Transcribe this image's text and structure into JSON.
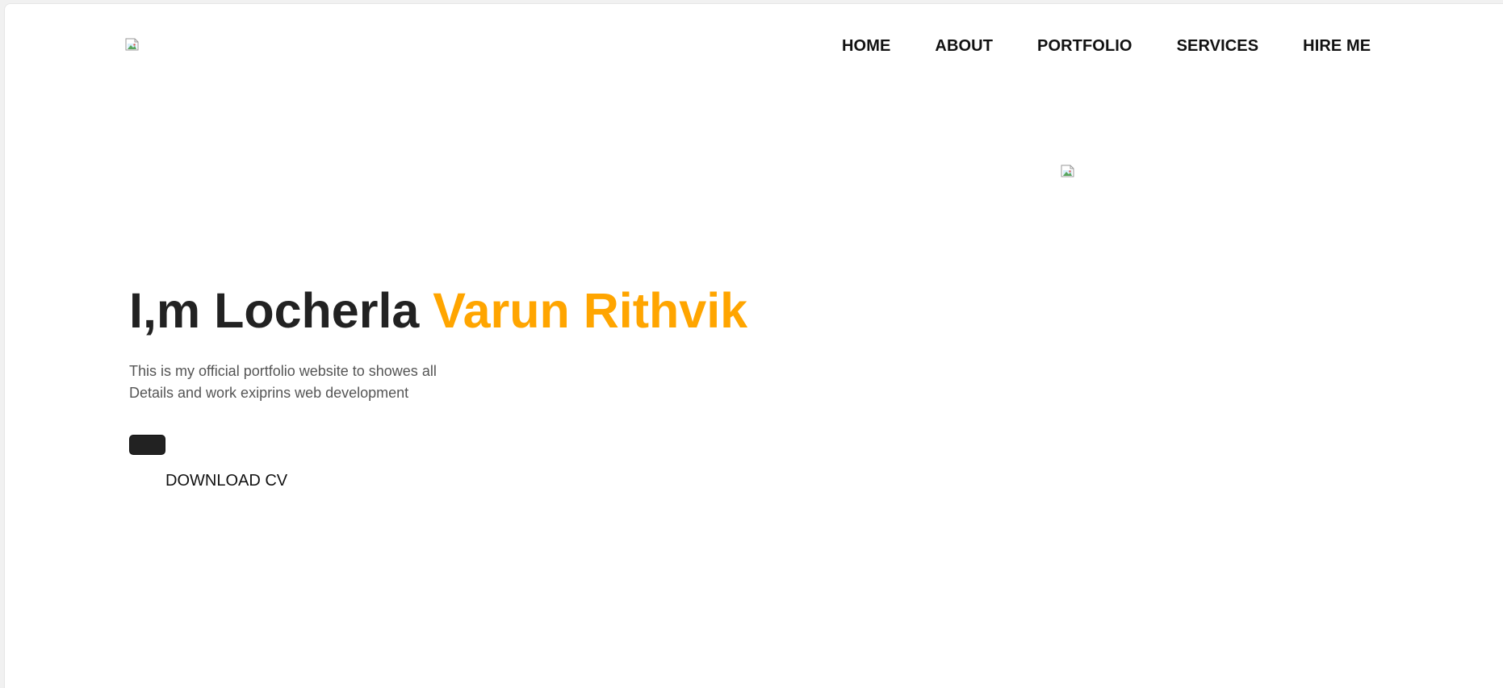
{
  "nav": {
    "items": [
      {
        "label": "HOME"
      },
      {
        "label": "ABOUT"
      },
      {
        "label": "PORTFOLIO"
      },
      {
        "label": "SERVICES"
      },
      {
        "label": "HIRE ME"
      }
    ]
  },
  "hero": {
    "headline_prefix": "I,m Locherla ",
    "headline_name": "Varun Rithvik",
    "description_line1": "This is my official portfolio website to showes all",
    "description_line2": "Details and work exiprins web development",
    "download_label": "DOWNLOAD CV"
  },
  "colors": {
    "accent": "#ffa500",
    "heading": "#222222",
    "body_text": "#555555",
    "button_bg": "#222222"
  },
  "icons": {
    "logo": "broken-image-icon",
    "hero_image": "broken-image-icon"
  }
}
